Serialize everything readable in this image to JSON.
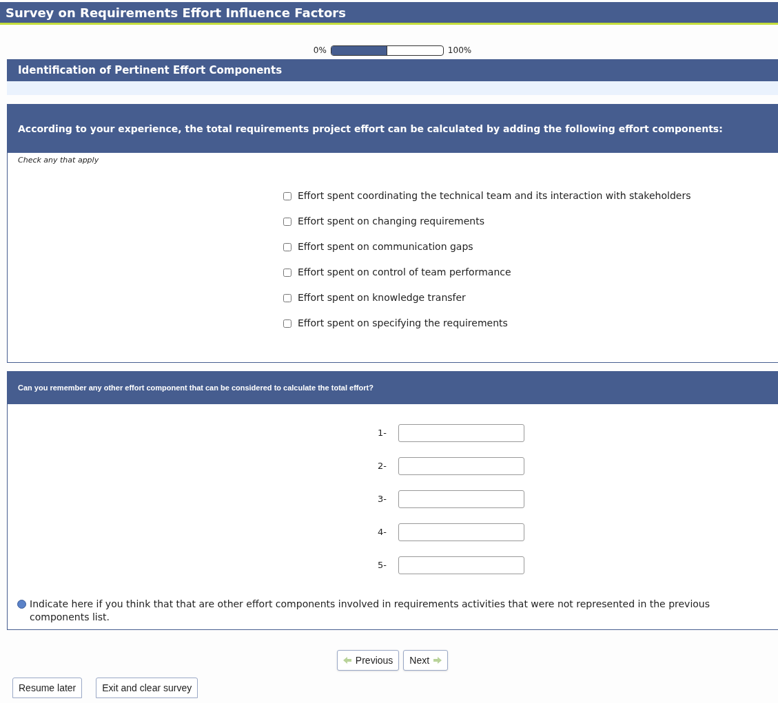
{
  "title": "Survey on Requirements Effort Influence Factors",
  "progress": {
    "start_label": "0%",
    "end_label": "100%",
    "level": 0.5
  },
  "section": {
    "title": "Identification of Pertinent Effort Components"
  },
  "question_1": {
    "text": "According to your experience, the total requirements project effort can be calculated by adding the following effort components:",
    "hint": "Check any that apply",
    "options": [
      {
        "label": "Effort spent coordinating the technical team and its interaction with stakeholders",
        "checked": false
      },
      {
        "label": "Effort spent on changing requirements",
        "checked": false
      },
      {
        "label": "Effort spent on communication gaps",
        "checked": false
      },
      {
        "label": "Effort spent on control of team performance",
        "checked": false
      },
      {
        "label": "Effort spent on knowledge transfer",
        "checked": false
      },
      {
        "label": "Effort spent on specifying the requirements",
        "checked": false
      }
    ]
  },
  "question_2": {
    "text": "Can you remember any other effort component that can be considered to calculate the total effort?",
    "fields": [
      {
        "label": "1-"
      },
      {
        "label": "2-"
      },
      {
        "label": "3-"
      },
      {
        "label": "4-"
      },
      {
        "label": "5-"
      }
    ],
    "help": "Indicate here if you think that that are other effort components involved in requirements activities that were not represented in the previous components list."
  },
  "nav": {
    "previous": "Previous",
    "next": "Next"
  },
  "footer_buttons": [
    "Resume later",
    "Exit and clear survey"
  ]
}
